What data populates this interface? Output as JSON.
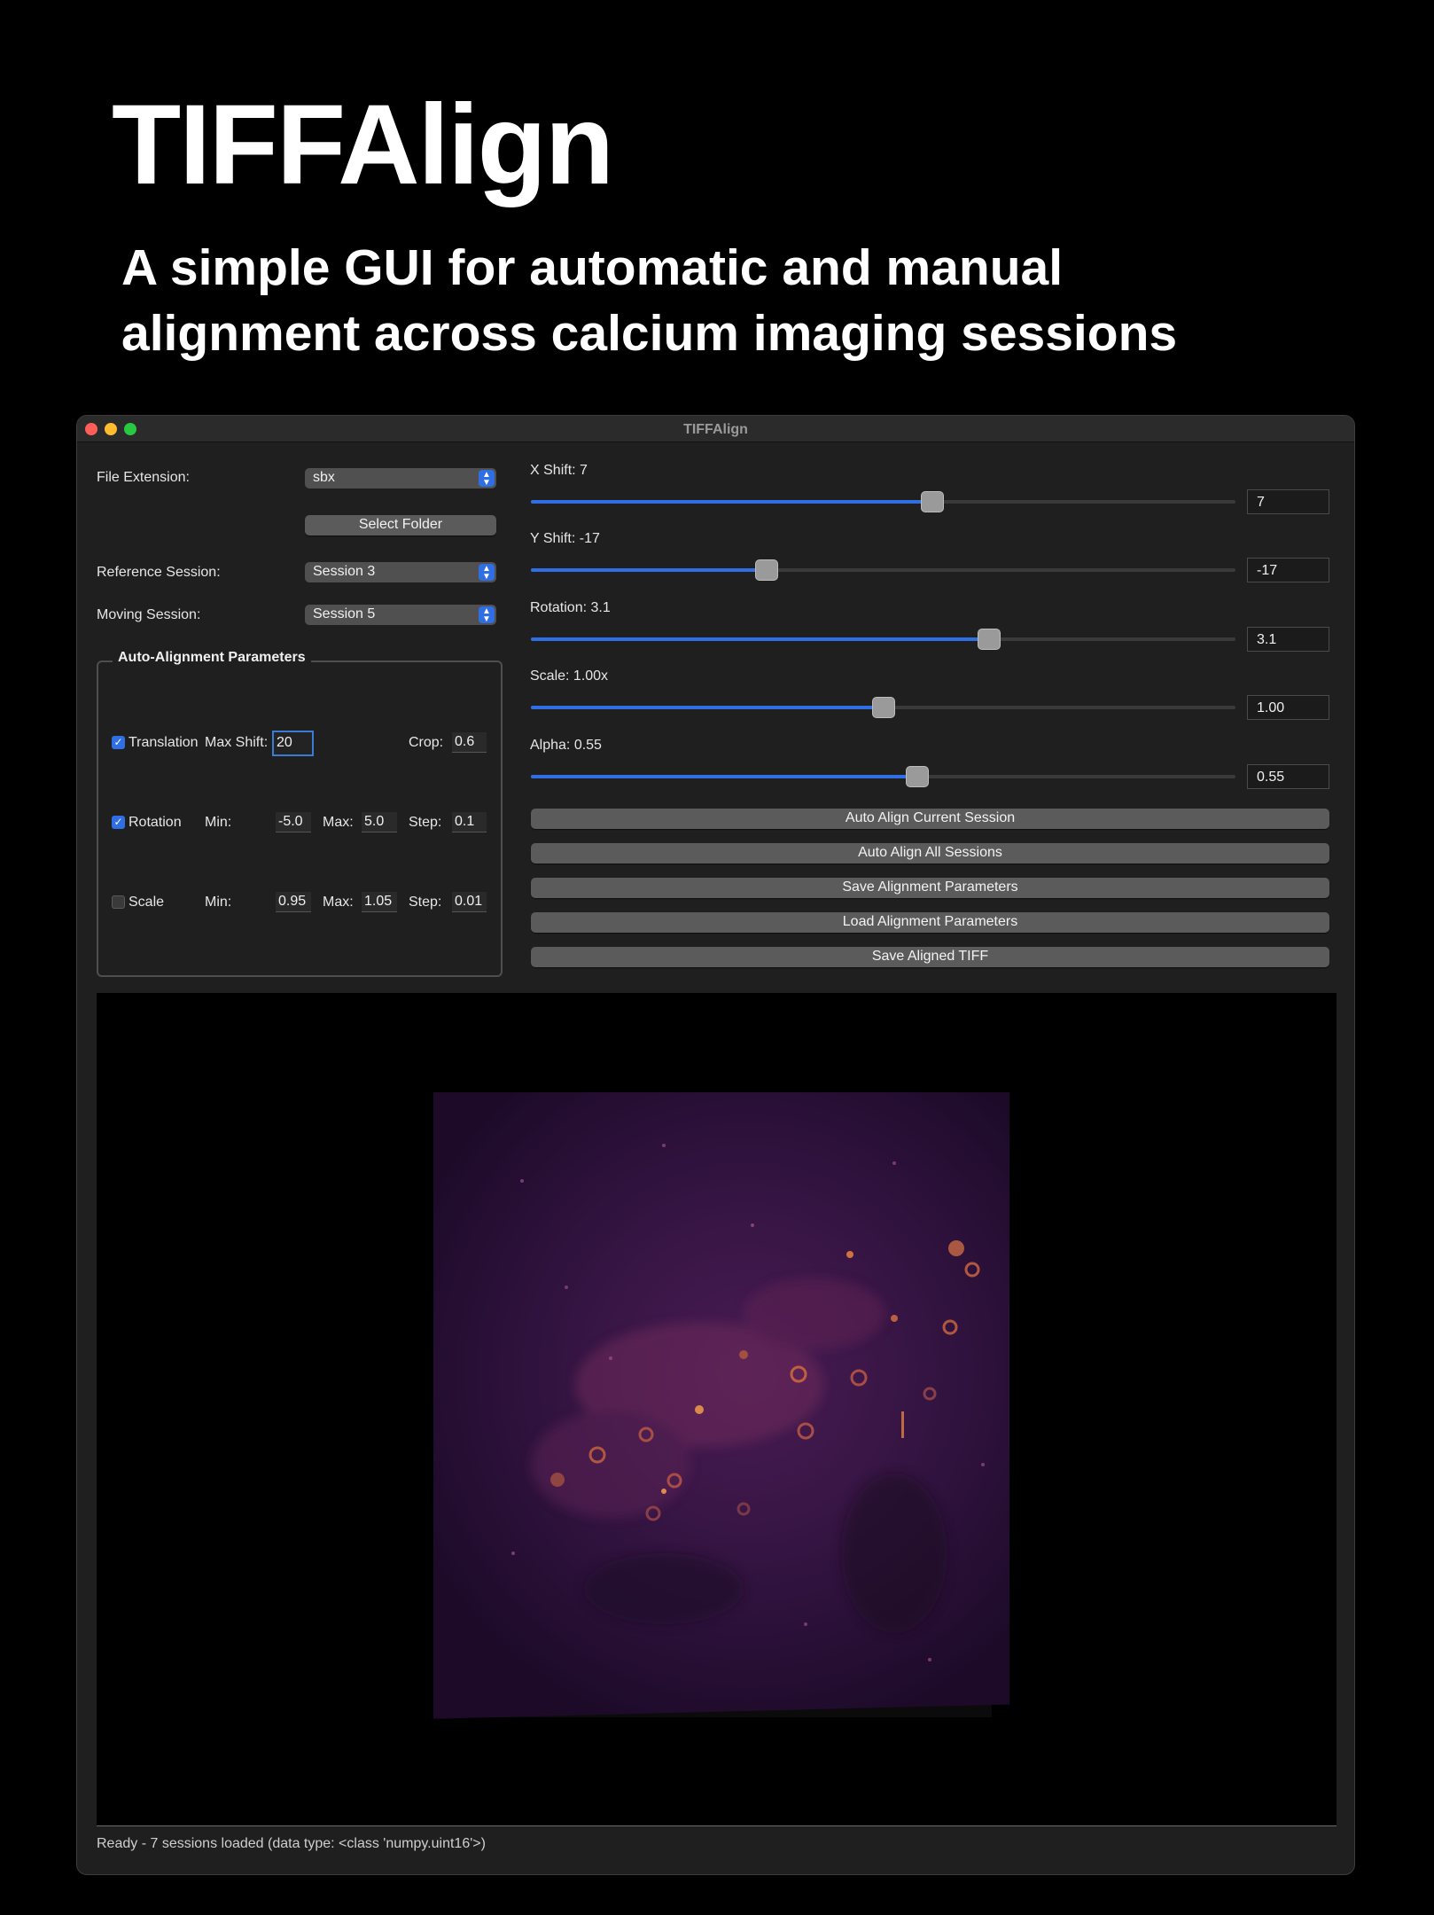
{
  "hero": {
    "title": "TIFFAlign",
    "subtitle": "A simple GUI for automatic and manual alignment across calcium imaging sessions"
  },
  "window": {
    "title": "TIFFAlign"
  },
  "left_panel": {
    "file_extension_label": "File Extension:",
    "file_extension_value": "sbx",
    "select_folder_label": "Select Folder",
    "reference_session_label": "Reference Session:",
    "reference_session_value": "Session 3",
    "moving_session_label": "Moving Session:",
    "moving_session_value": "Session 5"
  },
  "auto_params": {
    "group_title": "Auto-Alignment Parameters",
    "translation": {
      "label": "Translation",
      "checked": true,
      "max_shift_label": "Max Shift:",
      "max_shift_value": "20",
      "crop_label": "Crop:",
      "crop_value": "0.6"
    },
    "rotation": {
      "label": "Rotation",
      "checked": true,
      "min_label": "Min:",
      "min_value": "-5.0",
      "max_label": "Max:",
      "max_value": "5.0",
      "step_label": "Step:",
      "step_value": "0.1"
    },
    "scale": {
      "label": "Scale",
      "checked": false,
      "min_label": "Min:",
      "min_value": "0.95",
      "max_label": "Max:",
      "max_value": "1.05",
      "step_label": "Step:",
      "step_value": "0.01"
    }
  },
  "sliders": [
    {
      "label": "X Shift: 7",
      "value": "7",
      "fraction": 0.57
    },
    {
      "label": "Y Shift: -17",
      "value": "-17",
      "fraction": 0.335
    },
    {
      "label": "Rotation: 3.1",
      "value": "3.1",
      "fraction": 0.65
    },
    {
      "label": "Scale: 1.00x",
      "value": "1.00",
      "fraction": 0.5
    },
    {
      "label": "Alpha: 0.55",
      "value": "0.55",
      "fraction": 0.548
    }
  ],
  "actions": [
    "Auto Align Current Session",
    "Auto Align All Sessions",
    "Save Alignment Parameters",
    "Load Alignment Parameters",
    "Save Aligned TIFF"
  ],
  "status": "Ready - 7 sessions loaded (data type: <class 'numpy.uint16'>)",
  "colors": {
    "accent": "#2f6ee3",
    "close": "#ff5f57",
    "minimize": "#febc2e",
    "maximize": "#28c840",
    "image_base": "#2a0f3a",
    "image_highlight": "#e07a3c"
  }
}
